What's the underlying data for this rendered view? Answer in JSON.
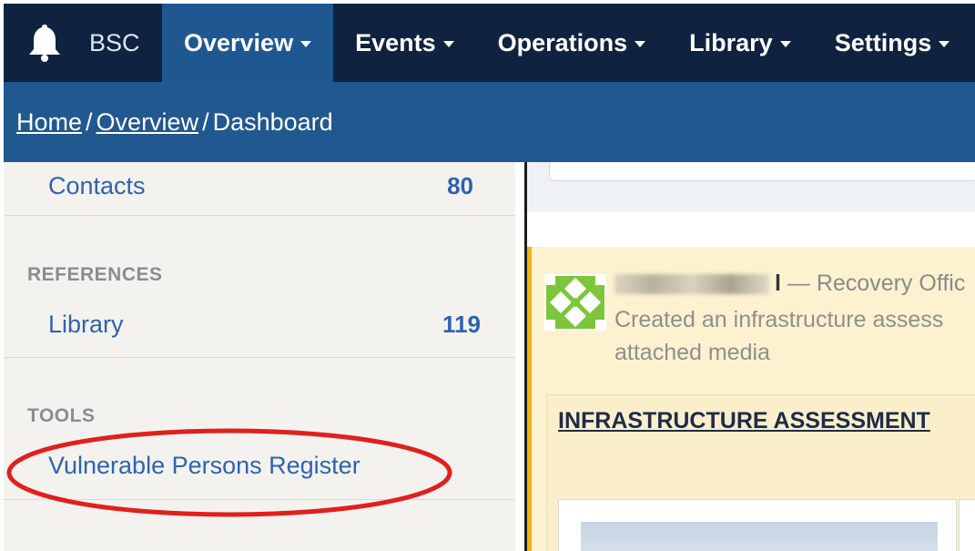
{
  "topnav": {
    "brand": "BSC",
    "items": [
      {
        "label": "Overview",
        "active": true
      },
      {
        "label": "Events",
        "active": false
      },
      {
        "label": "Operations",
        "active": false
      },
      {
        "label": "Library",
        "active": false
      },
      {
        "label": "Settings",
        "active": false
      }
    ]
  },
  "breadcrumb": {
    "home": "Home",
    "sep1": "/",
    "overview": "Overview",
    "sep2": "/",
    "current": "Dashboard"
  },
  "sidebar": {
    "contacts": {
      "label": "Contacts",
      "count": "80"
    },
    "references_heading": "REFERENCES",
    "library": {
      "label": "Library",
      "count": "119"
    },
    "tools_heading": "TOOLS",
    "vpr": {
      "label": "Vulnerable Persons Register"
    }
  },
  "feed": {
    "author_suffix": "l",
    "role": " — Recovery Offic",
    "description": "Created an infrastructure assess attached media",
    "assessment_title": "INFRASTRUCTURE ASSESSMENT"
  },
  "colors": {
    "nav_bg": "#0f2340",
    "nav_active": "#1f5791",
    "crumb_bg": "#21588f",
    "link": "#2d63b0",
    "feed_bg": "#fcf2cf",
    "feed_accent": "#f2b314",
    "annotation": "#e0201c"
  },
  "icons": {
    "brand": "bell-icon",
    "avatar": "identicon-avatar"
  }
}
